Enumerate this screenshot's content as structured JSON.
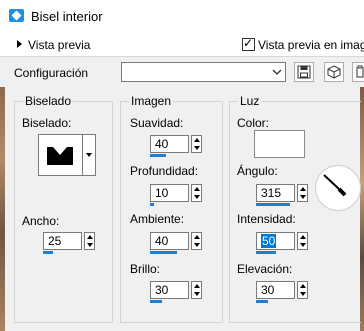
{
  "window": {
    "title": "Bisel interior"
  },
  "preview_bar": {
    "toggle_label": "Vista previa",
    "checkbox_label": "Vista previa en imagen",
    "checked": true
  },
  "toolbar": {
    "config_label": "Configuración",
    "config_value": ""
  },
  "bevel_group": {
    "legend": "Biselado",
    "bevel_label": "Biselado:",
    "width_label": "Ancho:",
    "width_value": "25",
    "width_level": 0.25
  },
  "image_group": {
    "legend": "Imagen",
    "smoothness_label": "Suavidad:",
    "smoothness_value": "40",
    "smoothness_level": 0.4,
    "depth_label": "Profundidad:",
    "depth_value": "10",
    "depth_level": 0.1,
    "ambience_label": "Ambiente:",
    "ambience_value": "40",
    "ambience_level": 0.7,
    "shininess_label": "Brillo:",
    "shininess_value": "30",
    "shininess_level": 0.3
  },
  "light_group": {
    "legend": "Luz",
    "color_label": "Color:",
    "color_value": "#ffffff",
    "angle_label": "Ángulo:",
    "angle_value": "315",
    "angle_level": 0.875,
    "intensity_label": "Intensidad:",
    "intensity_value": "50",
    "intensity_level": 0.5,
    "elevation_label": "Elevación:",
    "elevation_value": "30",
    "elevation_level": 0.3
  },
  "colors": {
    "accent": "#1e7fd9",
    "selection": "#0078d7"
  }
}
